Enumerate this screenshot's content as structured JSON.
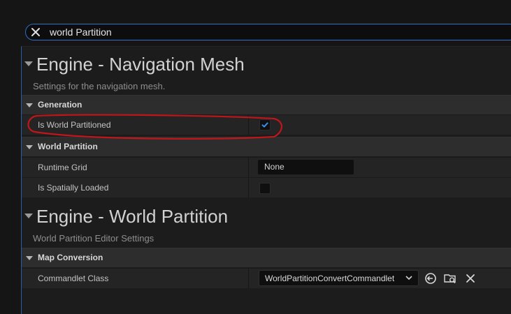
{
  "search": {
    "value": "world Partition",
    "clear_icon": "close-icon"
  },
  "sections": [
    {
      "title": "Engine - Navigation Mesh",
      "description": "Settings for the navigation mesh.",
      "categories": [
        {
          "label": "Generation",
          "rows": [
            {
              "name": "Is World Partitioned",
              "type": "checkbox",
              "checked": true
            }
          ]
        },
        {
          "label": "World Partition",
          "rows": [
            {
              "name": "Runtime Grid",
              "type": "text",
              "value": "None"
            },
            {
              "name": "Is Spatially Loaded",
              "type": "checkbox",
              "checked": false
            }
          ]
        }
      ]
    },
    {
      "title": "Engine - World Partition",
      "description": "World Partition Editor Settings",
      "categories": [
        {
          "label": "Map Conversion",
          "rows": [
            {
              "name": "Commandlet Class",
              "type": "combo",
              "value": "WorldPartitionConvertCommandlet",
              "actions": [
                "use-selected-icon",
                "browse-icon",
                "clear-icon"
              ]
            }
          ]
        }
      ]
    }
  ],
  "colors": {
    "accent": "#2f6fc7",
    "annotation": "#c0151b",
    "check": "#3d8bf0"
  }
}
